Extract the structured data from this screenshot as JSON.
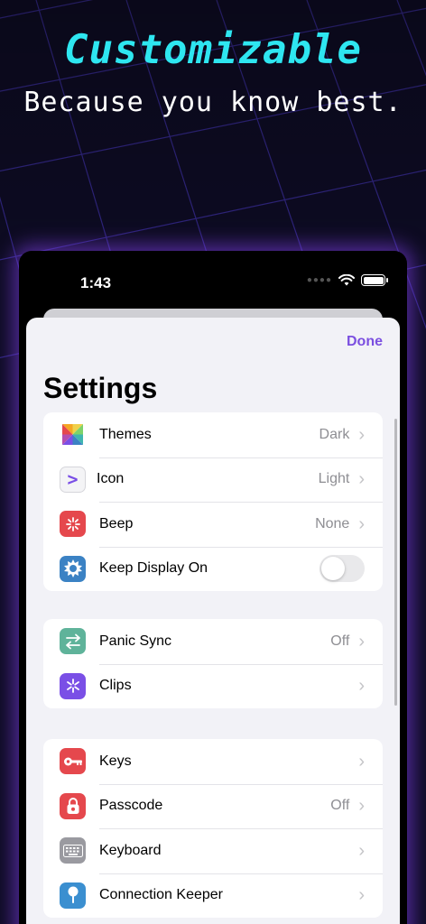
{
  "hero": {
    "title": "Customizable",
    "subtitle": "Because you know best."
  },
  "status_bar": {
    "time": "1:43",
    "signal_icon": "signal-dots-icon",
    "wifi_icon": "wifi-icon",
    "battery_icon": "battery-icon"
  },
  "sheet": {
    "done_label": "Done",
    "title": "Settings"
  },
  "groups": [
    {
      "rows": [
        {
          "label": "Themes",
          "value": "Dark",
          "icon": "themes-icon",
          "icon_color": "#ffffff"
        },
        {
          "label": "Icon",
          "value": "Light",
          "icon": "app-icon",
          "icon_color": "#f4f4f6"
        },
        {
          "label": "Beep",
          "value": "None",
          "icon": "beep-icon",
          "icon_color": "#e5484d"
        },
        {
          "label": "Keep Display On",
          "toggle_on": false,
          "icon": "display-icon",
          "icon_color": "#3b82c4"
        }
      ]
    },
    {
      "rows": [
        {
          "label": "Panic Sync",
          "value": "Off",
          "icon": "sync-icon",
          "icon_color": "#5fb39a"
        },
        {
          "label": "Clips",
          "value": "",
          "icon": "clips-icon",
          "icon_color": "#7a4fe6"
        }
      ]
    },
    {
      "rows": [
        {
          "label": "Keys",
          "value": "",
          "icon": "key-icon",
          "icon_color": "#e5484d"
        },
        {
          "label": "Passcode",
          "value": "Off",
          "icon": "lock-icon",
          "icon_color": "#e5484d"
        },
        {
          "label": "Keyboard",
          "value": "",
          "icon": "keyboard-icon",
          "icon_color": "#9a9aa0"
        },
        {
          "label": "Connection Keeper",
          "value": "",
          "icon": "pin-icon",
          "icon_color": "#3b8fd0"
        }
      ]
    }
  ],
  "colors": {
    "accent": "#7b4fe0",
    "hero_title": "#2ee6f0",
    "background": "#0d0b22",
    "glow": "#8c46ff"
  }
}
